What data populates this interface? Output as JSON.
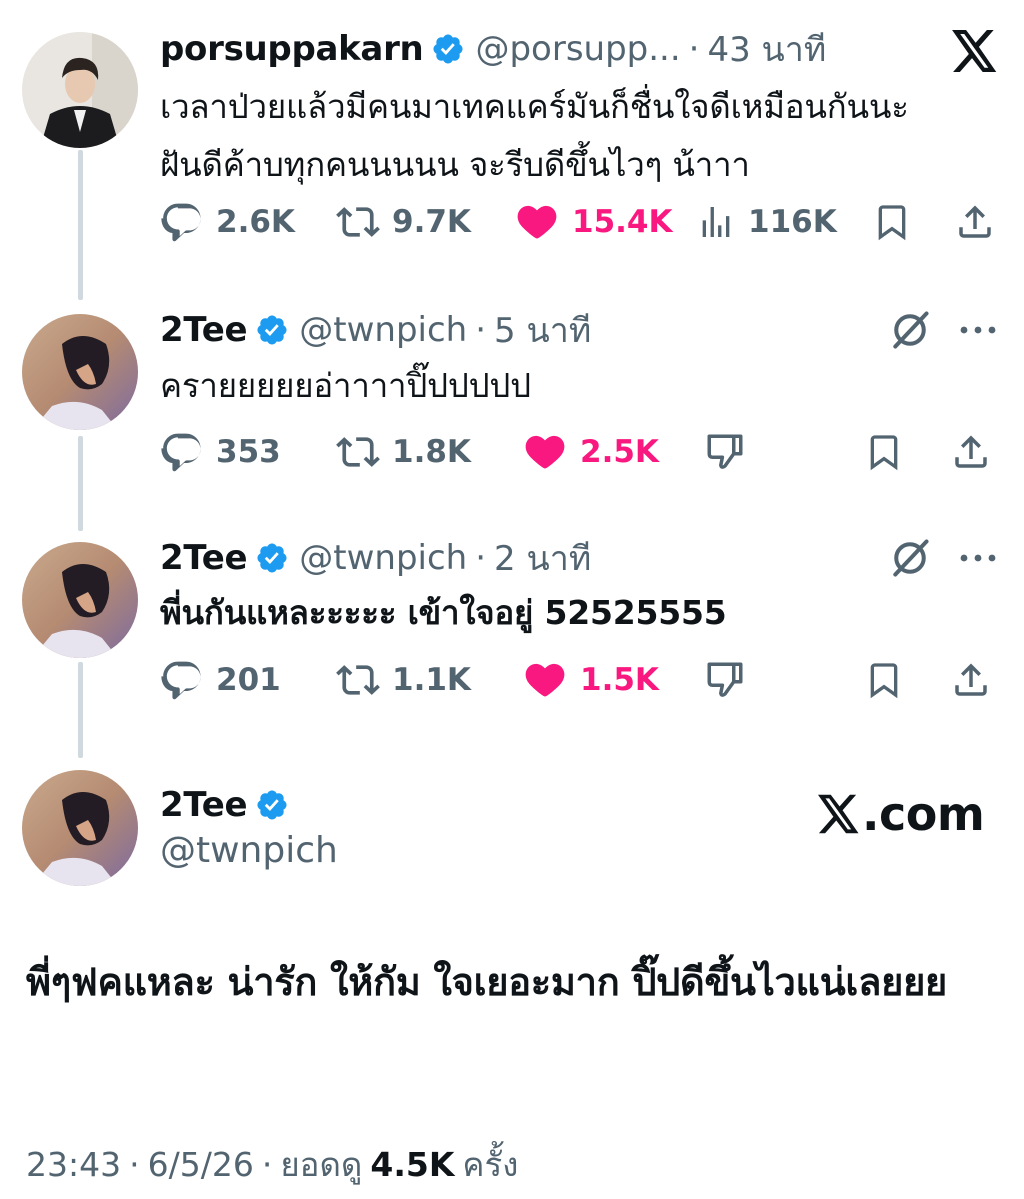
{
  "tweets": [
    {
      "name": "porsuppakarn",
      "handle": "@porsupp...",
      "time": "43 นาที",
      "text": "เวลาป่วยแล้วมีคนมาเทคแคร์มันก็ชื่นใจดีเหมือนกันนะ\nฝันดีค้าบทุกคนนนนน จะรีบดีขึ้นไวๆ น้าาา",
      "replies": "2.6K",
      "reposts": "9.7K",
      "likes": "15.4K",
      "views": "116K"
    },
    {
      "name": "2Tee",
      "handle": "@twnpich",
      "time": "5 นาที",
      "text": "ครายยยยยอ่าาาาปิ๊ปปปปป",
      "replies": "353",
      "reposts": "1.8K",
      "likes": "2.5K"
    },
    {
      "name": "2Tee",
      "handle": "@twnpich",
      "time": "2 นาที",
      "text": "พี่นกันแหละะะะะ เข้าใจอยู่ 52525555",
      "replies": "201",
      "reposts": "1.1K",
      "likes": "1.5K"
    }
  ],
  "quote": {
    "name": "2Tee",
    "handle": "@twnpich",
    "site": ".com",
    "text": "พี่ๆฟคแหละ น่ารัก ให้กัม ใจเยอะมาก ปิ๊ปดีขึ้นไวแน่เลยยย"
  },
  "footer": {
    "time": "23:43",
    "date": "6/5/26",
    "views_label": "ยอดดู",
    "views": "4.5K",
    "views_suffix": "ครั้ง"
  },
  "colors": {
    "like": "#f91880",
    "muted": "#536471",
    "verified": "#1d9bf0",
    "thread_line": "#cfd9de"
  },
  "icons": [
    "reply-icon",
    "repost-icon",
    "like-icon",
    "views-icon",
    "bookmark-icon",
    "share-icon",
    "dislike-icon",
    "grok-icon",
    "more-icon",
    "x-logo",
    "verified-badge-icon"
  ]
}
